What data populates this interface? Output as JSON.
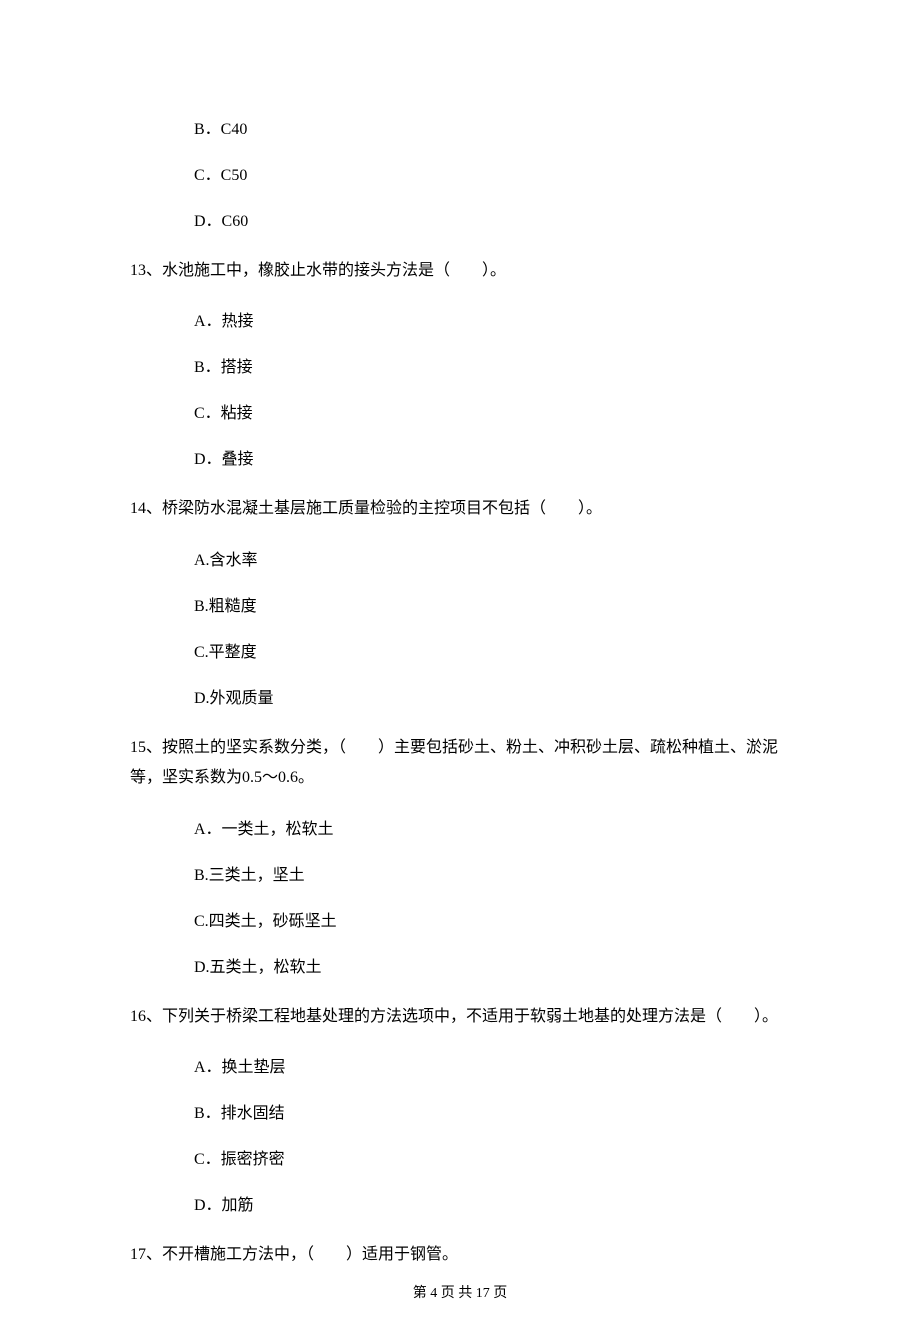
{
  "options_pre": [
    "B．C40",
    "C．C50",
    "D．C60"
  ],
  "q13": {
    "stem": "13、水池施工中，橡胶止水带的接头方法是（　　）。",
    "options": [
      "A．热接",
      "B．搭接",
      "C．粘接",
      "D．叠接"
    ]
  },
  "q14": {
    "stem": "14、桥梁防水混凝土基层施工质量检验的主控项目不包括（　　）。",
    "options": [
      "A.含水率",
      "B.粗糙度",
      "C.平整度",
      "D.外观质量"
    ]
  },
  "q15": {
    "stem": "15、按照土的坚实系数分类，（　　）主要包括砂土、粉土、冲积砂土层、疏松种植土、淤泥等，坚实系数为0.5～0.6。",
    "options": [
      "A．一类土，松软土",
      "B.三类土，坚土",
      "C.四类土，砂砾坚土",
      "D.五类土，松软土"
    ]
  },
  "q16": {
    "stem": "16、下列关于桥梁工程地基处理的方法选项中，不适用于软弱土地基的处理方法是（　　）。",
    "options": [
      "A．换土垫层",
      "B．排水固结",
      "C．振密挤密",
      "D．加筋"
    ]
  },
  "q17": {
    "stem": "17、不开槽施工方法中，（　　）适用于钢管。"
  },
  "footer": "第 4 页 共 17 页"
}
